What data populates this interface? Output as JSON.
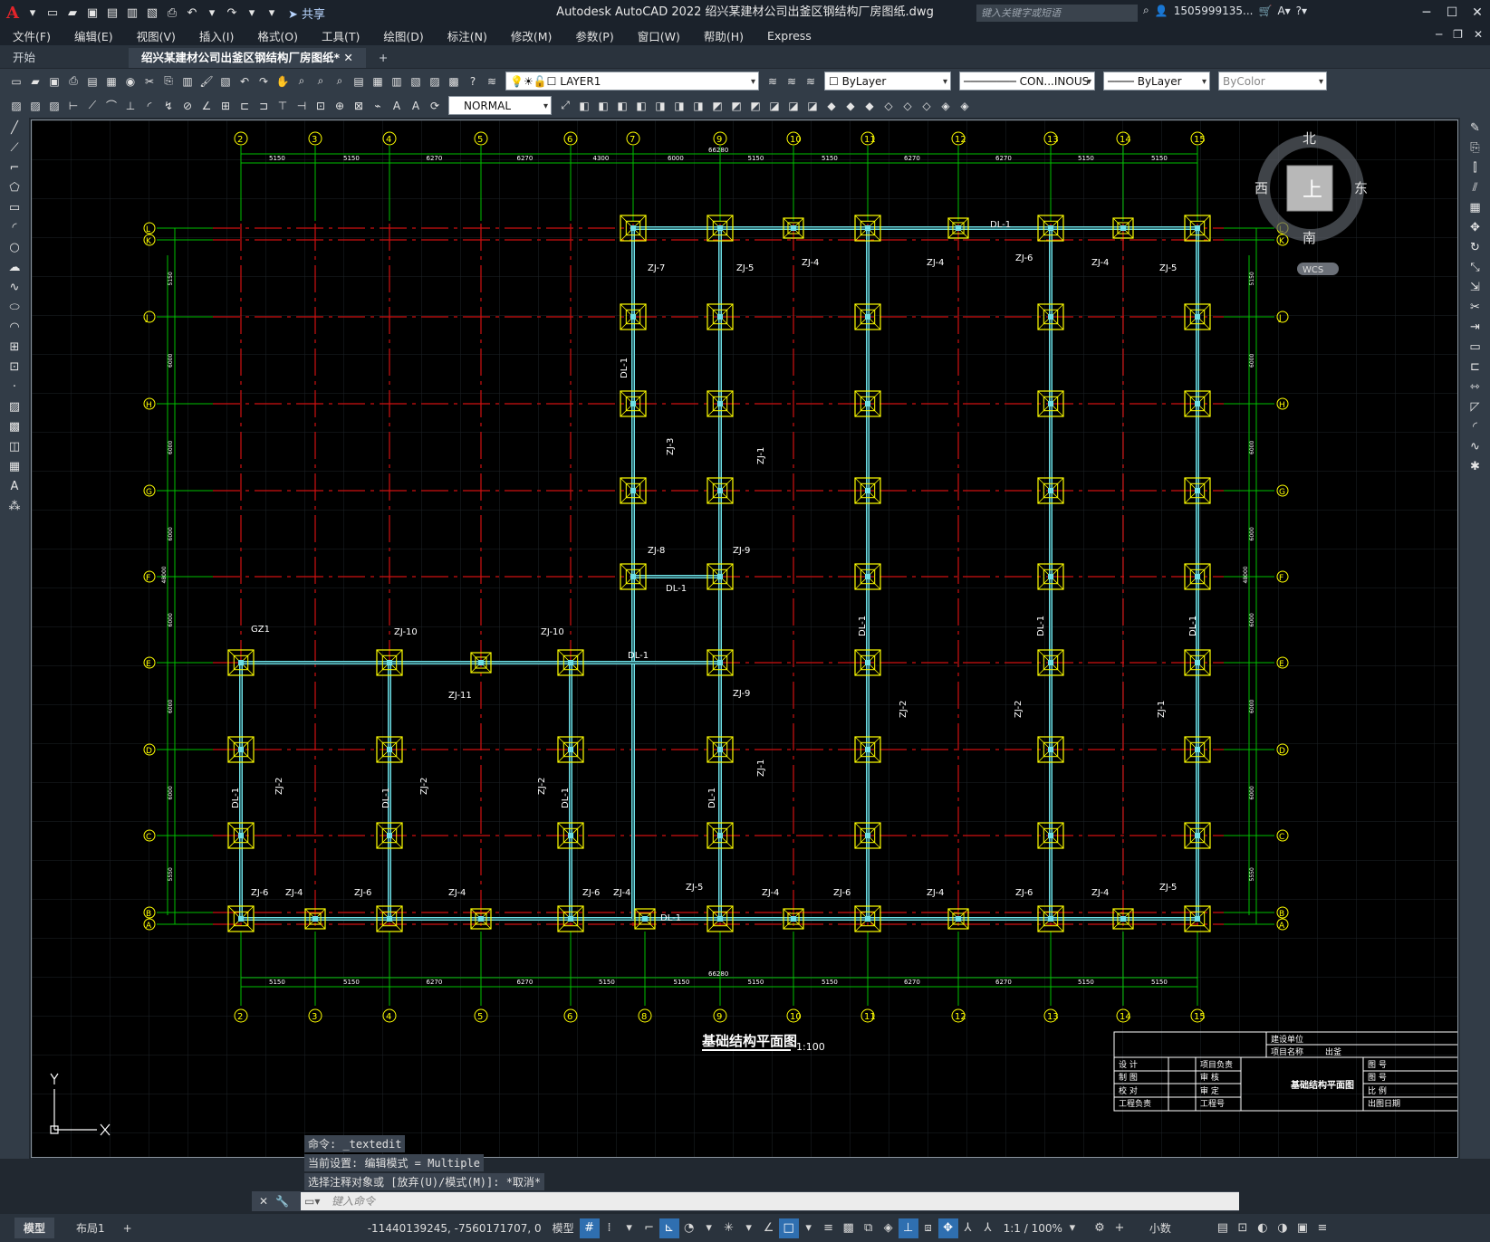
{
  "titlebar": {
    "app_title": "Autodesk AutoCAD 2022    绍兴某建材公司出釜区钢结构厂房图纸.dwg",
    "share": "共享",
    "search_placeholder": "键入关键字或短语",
    "user": "1505999135..."
  },
  "menu": [
    "文件(F)",
    "编辑(E)",
    "视图(V)",
    "插入(I)",
    "格式(O)",
    "工具(T)",
    "绘图(D)",
    "标注(N)",
    "修改(M)",
    "参数(P)",
    "窗口(W)",
    "帮助(H)",
    "Express"
  ],
  "tabs": {
    "start": "开始",
    "file": "绍兴某建材公司出釜区钢结构厂房图纸*"
  },
  "properties": {
    "layer": "LAYER1",
    "color": "ByLayer",
    "linetype": "CON...INOUS",
    "lineweight": "ByLayer",
    "plotstyle": "ByColor",
    "dimstyle": "NORMAL"
  },
  "viewcube": {
    "north": "北",
    "south": "南",
    "east": "东",
    "west": "西",
    "top": "上",
    "wcs": "WCS"
  },
  "drawing": {
    "col_top": [
      "2",
      "3",
      "4",
      "5",
      "6",
      "7",
      "9",
      "10",
      "11",
      "12",
      "13",
      "14",
      "15"
    ],
    "col_bottom": [
      "2",
      "3",
      "4",
      "5",
      "6",
      "8",
      "9",
      "10",
      "11",
      "12",
      "13",
      "14",
      "15"
    ],
    "rows": [
      "L",
      "K",
      "J",
      "H",
      "G",
      "F",
      "E",
      "D",
      "C",
      "B",
      "A"
    ],
    "dims_top": [
      "5150",
      "5150",
      "6270",
      "6270",
      "4300",
      "6000",
      "5150",
      "5150",
      "6270",
      "6270",
      "5150",
      "5150"
    ],
    "dims_bottom": [
      "5150",
      "5150",
      "6270",
      "6270",
      "5150",
      "5150",
      "5150",
      "5150",
      "6270",
      "6270",
      "5150",
      "5150"
    ],
    "total": "66280",
    "side_dims": [
      "5150",
      "6000",
      "6000",
      "6000",
      "6000",
      "6000",
      "6000",
      "5550"
    ],
    "side_total": "48000",
    "labels": {
      "zj7": "ZJ-7",
      "zj5": "ZJ-5",
      "zj4": "ZJ-4",
      "zj6": "ZJ-6",
      "zj3": "ZJ-3",
      "zj1": "ZJ-1",
      "zj2": "ZJ-2",
      "zj8": "ZJ-8",
      "zj9": "ZJ-9",
      "zj10": "ZJ-10",
      "zj11": "ZJ-11",
      "dl1": "DL-1",
      "gz1": "GZ1"
    },
    "plan_title": "基础结构平面图",
    "scale": "1:100",
    "titleblock": {
      "owner": "建设单位",
      "project": "项目名称",
      "proj_val": "出釜",
      "sheet": "基础结构平面图",
      "rows1": [
        "设 计",
        "制 图",
        "校 对",
        "工程负责"
      ],
      "rows2": [
        "项目负责",
        "审 核",
        "审 定",
        "工程号"
      ],
      "rows3": [
        "图 号",
        "图 号",
        "比 例",
        "出图日期"
      ]
    }
  },
  "command": {
    "history": [
      "命令: _textedit",
      "当前设置: 编辑模式 = Multiple",
      "选择注释对象或 [放弃(U)/模式(M)]: *取消*"
    ],
    "placeholder": "键入命令"
  },
  "status": {
    "model": "模型",
    "layout": "布局1",
    "coords": "-11440139245, -7560171707, 0",
    "model_btn": "模型",
    "scale": "1:1 / 100%",
    "units": "小数"
  }
}
